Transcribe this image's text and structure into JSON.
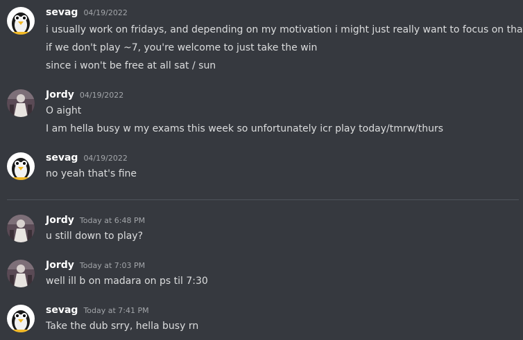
{
  "messages": [
    {
      "author": "sevag",
      "avatar_icon": "penguin-avatar",
      "timestamp": "04/19/2022",
      "lines": [
        "i usually work on fridays, and depending on my motivation i might just really want to focus on that",
        "if we don't play ~7, you're welcome to just take the win",
        "since i won't be free at all sat / sun"
      ]
    },
    {
      "author": "Jordy",
      "avatar_icon": "photo-avatar",
      "timestamp": "04/19/2022",
      "lines": [
        "O aight",
        "I am hella busy w my exams this week so unfortunately icr play today/tmrw/thurs"
      ]
    },
    {
      "author": "sevag",
      "avatar_icon": "penguin-avatar",
      "timestamp": "04/19/2022",
      "lines": [
        "no yeah that's fine"
      ]
    },
    {
      "author": "Jordy",
      "avatar_icon": "photo-avatar",
      "timestamp": "Today at 6:48 PM",
      "lines": [
        "u still down to play?"
      ]
    },
    {
      "author": "Jordy",
      "avatar_icon": "photo-avatar",
      "timestamp": "Today at 7:03 PM",
      "lines": [
        "well ill b on madara on ps til 7:30"
      ]
    },
    {
      "author": "sevag",
      "avatar_icon": "penguin-avatar",
      "timestamp": "Today at 7:41 PM",
      "lines": [
        "Take the dub srry, hella busy rn"
      ]
    }
  ],
  "colors": {
    "background": "#36393f",
    "author": "#ffffff",
    "timestamp": "#a3a6aa",
    "text": "#dcddde",
    "divider": "#4f545c"
  }
}
